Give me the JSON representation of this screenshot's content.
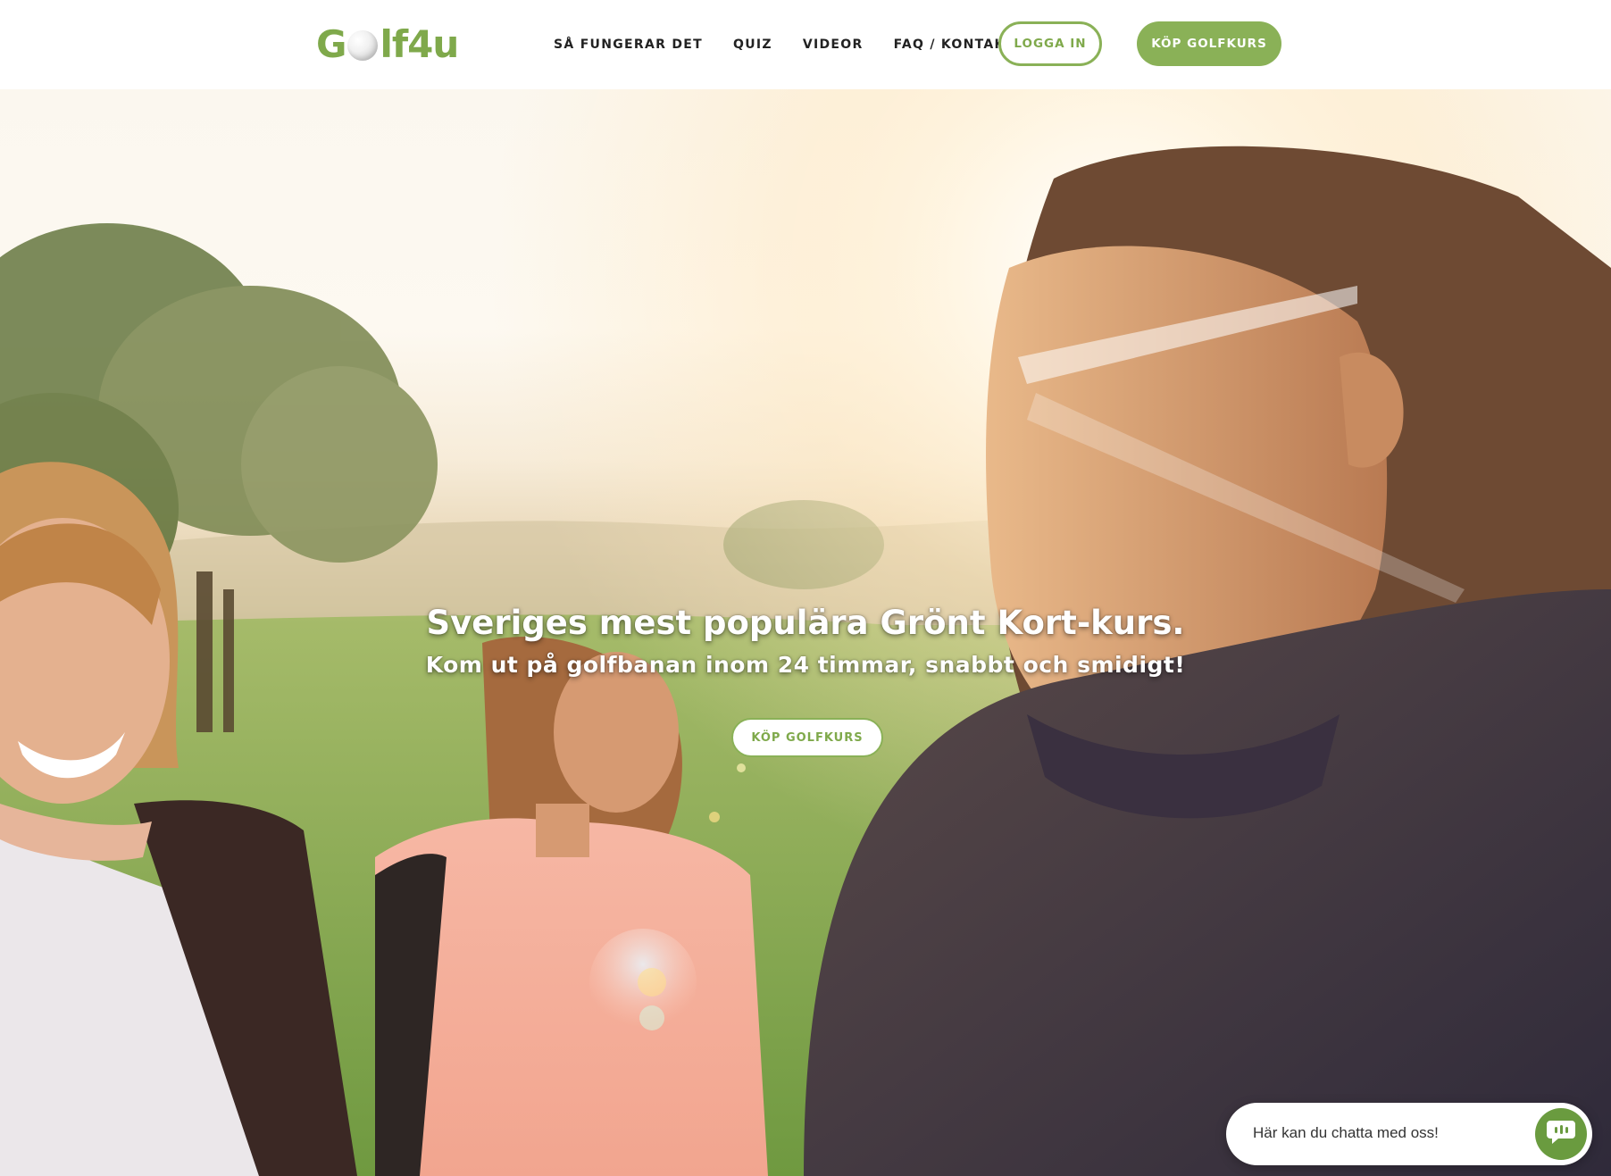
{
  "header": {
    "logo_prefix": "G",
    "logo_suffix": "lf4u",
    "nav": [
      {
        "label": "SÅ FUNGERAR DET"
      },
      {
        "label": "QUIZ"
      },
      {
        "label": "VIDEOR"
      },
      {
        "label": "FAQ / KONTAKT"
      }
    ],
    "login_label": "LOGGA IN",
    "buy_label": "KÖP GOLFKURS"
  },
  "hero": {
    "title": "Sveriges mest populära Grönt Kort-kurs.",
    "subtitle": "Kom ut på golfbanan inom 24 timmar, snabbt och smidigt!",
    "cta_label": "KÖP GOLFKURS"
  },
  "chat": {
    "text": "Här kan du chatta med oss!",
    "icon": "chat-bubble-icon"
  },
  "colors": {
    "brand_green": "#8ab157",
    "logo_green": "#7fa94b",
    "chat_green": "#6a9b3f"
  }
}
